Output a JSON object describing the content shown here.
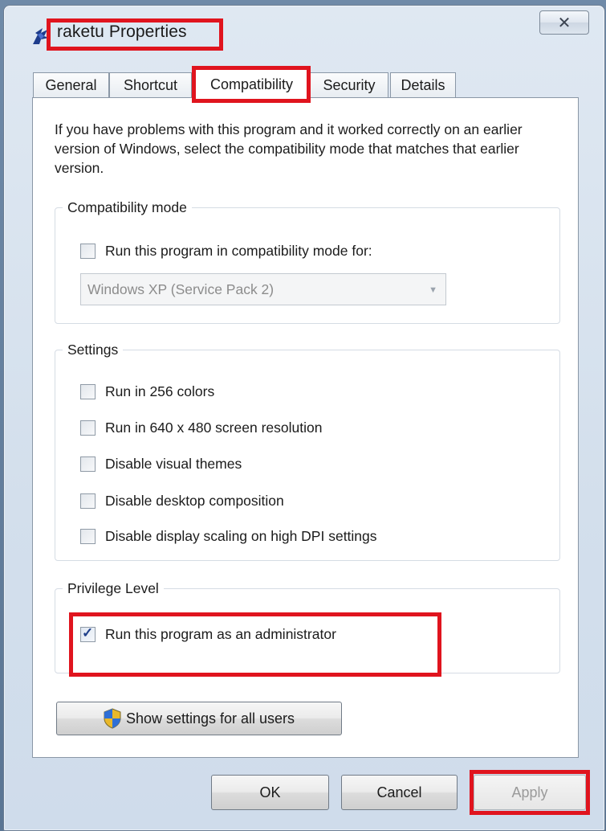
{
  "window": {
    "title": "raketu Properties",
    "close_symbol": "✕"
  },
  "tabs": [
    {
      "label": "General",
      "active": false
    },
    {
      "label": "Shortcut",
      "active": false
    },
    {
      "label": "Compatibility",
      "active": true
    },
    {
      "label": "Security",
      "active": false
    },
    {
      "label": "Details",
      "active": false
    }
  ],
  "intro_text": "If you have problems with this program and it worked correctly on an earlier version of Windows, select the compatibility mode that matches that earlier version.",
  "compatibility_mode": {
    "group_title": "Compatibility mode",
    "checkbox_label": "Run this program in compatibility mode for:",
    "checked": false,
    "selected_os": "Windows XP (Service Pack 2)"
  },
  "settings": {
    "group_title": "Settings",
    "options": [
      {
        "label": "Run in 256 colors",
        "checked": false
      },
      {
        "label": "Run in 640 x 480 screen resolution",
        "checked": false
      },
      {
        "label": "Disable visual themes",
        "checked": false
      },
      {
        "label": "Disable desktop composition",
        "checked": false
      },
      {
        "label": "Disable display scaling on high DPI settings",
        "checked": false
      }
    ]
  },
  "privilege": {
    "group_title": "Privilege Level",
    "checkbox_label": "Run this program as an administrator",
    "checked": true
  },
  "buttons": {
    "show_all_users": "Show settings for all users",
    "ok": "OK",
    "cancel": "Cancel",
    "apply": "Apply"
  },
  "colors": {
    "highlight": "#e0141e",
    "checkmark": "#1f3f8a"
  }
}
